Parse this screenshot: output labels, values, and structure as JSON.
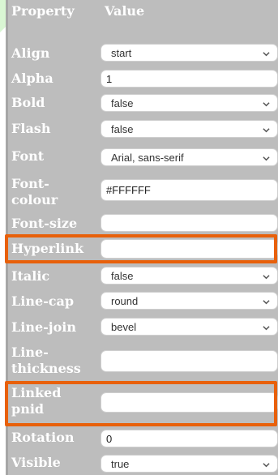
{
  "header": {
    "property": "Property",
    "value": "Value"
  },
  "rows": [
    {
      "label": "Align",
      "type": "select",
      "value": "start"
    },
    {
      "label": "Alpha",
      "type": "input",
      "value": "1"
    },
    {
      "label": "Bold",
      "type": "select",
      "value": "false"
    },
    {
      "label": "Flash",
      "type": "select",
      "value": "false"
    },
    {
      "label": "Font",
      "type": "select",
      "value": "Arial, sans-serif"
    },
    {
      "label": "Font-\ncolour",
      "type": "input",
      "value": "#FFFFFF"
    },
    {
      "label": "Font-size",
      "type": "input",
      "value": ""
    },
    {
      "label": "Hyperlink",
      "type": "input",
      "value": ""
    },
    {
      "label": "Italic",
      "type": "select",
      "value": "false"
    },
    {
      "label": "Line-cap",
      "type": "select",
      "value": "round"
    },
    {
      "label": "Line-join",
      "type": "select",
      "value": "bevel"
    },
    {
      "label": "Line-\nthickness",
      "type": "input",
      "value": ""
    },
    {
      "label": "Linked\npnid",
      "type": "input",
      "value": ""
    },
    {
      "label": "Rotation",
      "type": "input",
      "value": "0"
    },
    {
      "label": "Visible",
      "type": "select",
      "value": "true"
    }
  ],
  "colors": {
    "panel": "#bdbdbd",
    "highlight": "#e8600a",
    "label_text": "#ffffff",
    "background_stripes": "#d9f6d3"
  },
  "icons": {
    "dropdown": "chevron-down-icon"
  }
}
